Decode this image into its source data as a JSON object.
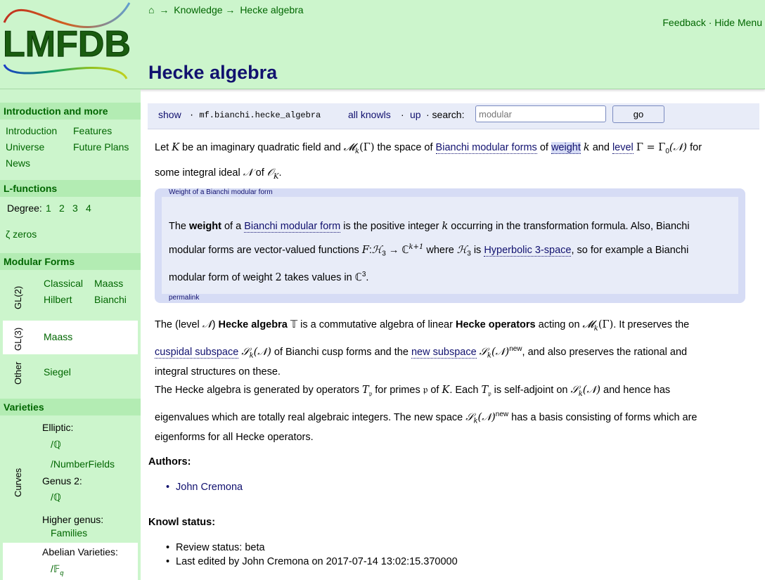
{
  "header": {
    "logo_text": "LMFDB",
    "breadcrumb": {
      "home_icon": "⌂",
      "sep": "→",
      "items": [
        "Knowledge",
        "Hecke algebra"
      ]
    },
    "title": "Hecke algebra",
    "feedback": "Feedback",
    "separator": "·",
    "hide_menu": "Hide Menu"
  },
  "sidebar": {
    "intro": {
      "heading": "Introduction and more",
      "items": [
        "Introduction",
        "Features",
        "Universe",
        "Future Plans",
        "News"
      ]
    },
    "lfunctions": {
      "heading": "L-functions",
      "degree_label": "Degree:",
      "degrees": [
        "1",
        "2",
        "3",
        "4"
      ],
      "zeros": "ζ zeros"
    },
    "modular": {
      "heading": "Modular Forms",
      "gl2_label": "GL(2)",
      "gl2_items": [
        "Classical",
        "Maass",
        "Hilbert",
        "Bianchi"
      ],
      "gl3_label": "GL(3)",
      "gl3_items": [
        "Maass"
      ],
      "other_label": "Other",
      "other_items": [
        "Siegel"
      ]
    },
    "varieties": {
      "heading": "Varieties",
      "curves_label": "Curves",
      "elliptic": "Elliptic:",
      "elliptic_items": [
        "/ℚ",
        "/NumberFields"
      ],
      "genus2": "Genus 2:",
      "genus2_items": [
        "/ℚ"
      ],
      "higher": "Higher genus:",
      "higher_items": [
        "Families"
      ],
      "abelian": "Abelian Varieties:",
      "abelian_items": [
        "/𝔽"
      ],
      "abelian_sub": "q"
    }
  },
  "knowlbar": {
    "show": "show",
    "knowl_id": "· mf.bianchi.hecke_algebra",
    "all_knowls": "all knowls",
    "dot": "·",
    "up": "up",
    "search_label": "· search:",
    "search_placeholder": "modular",
    "go": "go"
  },
  "content": {
    "p1": {
      "t1": "Let ",
      "K": "K",
      "t2": " be an imaginary quadratic field and ",
      "M": "𝓜",
      "k": "k",
      "Gamma": "(Γ)",
      "t3": " the space of ",
      "link_bianchi": "Bianchi modular forms",
      "t4": " of ",
      "link_weight": "weight",
      "t5": " ",
      "k2": "k",
      "t6": " and ",
      "link_level": "level",
      "t7": " ",
      "level_eq": "Γ = Γ",
      "sub0": "0",
      "N": "(𝒩)",
      "t8": " for",
      "t9": "some integral ideal ",
      "N2": "𝒩",
      "t10": " of ",
      "O": "𝒪",
      "OK": "K",
      "t11": "."
    },
    "knowl": {
      "title": "Weight of a Bianchi modular form",
      "the": "The ",
      "weight_bold": "weight",
      "of_a": " of a ",
      "link_bmf": "Bianchi modular form",
      "is_pos": " is the positive integer ",
      "k": "k",
      "occ": " occurring in the transformation formula. Also, Bianchi",
      "line2a": "modular forms are vector-valued functions ",
      "F": "F",
      "colon": ":",
      "H3": "ℋ",
      "sub3": "3",
      "arrow": " → ℂ",
      "sup": "k+1",
      "where": " where ",
      "H3b": "ℋ",
      "sub3b": "3",
      "is": " is ",
      "link_hyp": "Hyperbolic 3-space",
      "line2b": ", so for example a Bianchi",
      "line3": "modular form of weight ",
      "two": "2",
      "takes": " takes values in ",
      "C": "ℂ",
      "sup3": "3",
      "dot": ".",
      "permalink": "permalink"
    },
    "p2": {
      "t1": "The (level ",
      "N": "𝒩",
      "t2": ") ",
      "hecke_bold": "Hecke algebra",
      "t3": " ",
      "T": "𝕋",
      "t4": " is a commutative algebra of linear ",
      "ops_bold": "Hecke operators",
      "t5": " acting on ",
      "M": "𝓜",
      "k": "k",
      "G": "(Γ)",
      "t6": ". It preserves the",
      "link_cusp": "cuspidal subspace",
      "t7": " ",
      "S": "𝒮",
      "k2": "k",
      "N2": "(𝒩)",
      "t8": " of Bianchi cusp forms and the ",
      "link_new": "new subspace",
      "t9": " ",
      "S2": "𝒮",
      "k3": "k",
      "N3": "(𝒩)",
      "new": "new",
      "t10": ", and also preserves the rational and",
      "t11": "integral structures on these."
    },
    "p3": {
      "t1": "The Hecke algebra is generated by operators ",
      "T": "T",
      "p": "𝔭",
      "t2": " for primes ",
      "p2": "𝔭",
      "t3": " of ",
      "K": "K",
      "t4": ". Each ",
      "T2": "T",
      "p3": "𝔭",
      "t5": " is self-adjoint on ",
      "S": "𝒮",
      "k": "k",
      "N": "(𝒩)",
      "t6": " and hence has",
      "t7": "eigenvalues which are totally real algebraic integers. The new space ",
      "S2": "𝒮",
      "k2": "k",
      "N2": "(𝒩)",
      "new": "new",
      "t8": " has a basis consisting of forms which are",
      "t9": "eigenforms for all Hecke operators."
    },
    "authors_heading": "Authors:",
    "authors": [
      "John Cremona"
    ],
    "status_heading": "Knowl status:",
    "status": [
      "Review status: beta",
      "Last edited by John Cremona on 2017-07-14 13:02:15.370000"
    ]
  },
  "colors": {
    "green_text": "#006600",
    "blue_text": "#11116f",
    "header_bg": "#ccf5cc",
    "box_bg": "#d6dcf5"
  }
}
